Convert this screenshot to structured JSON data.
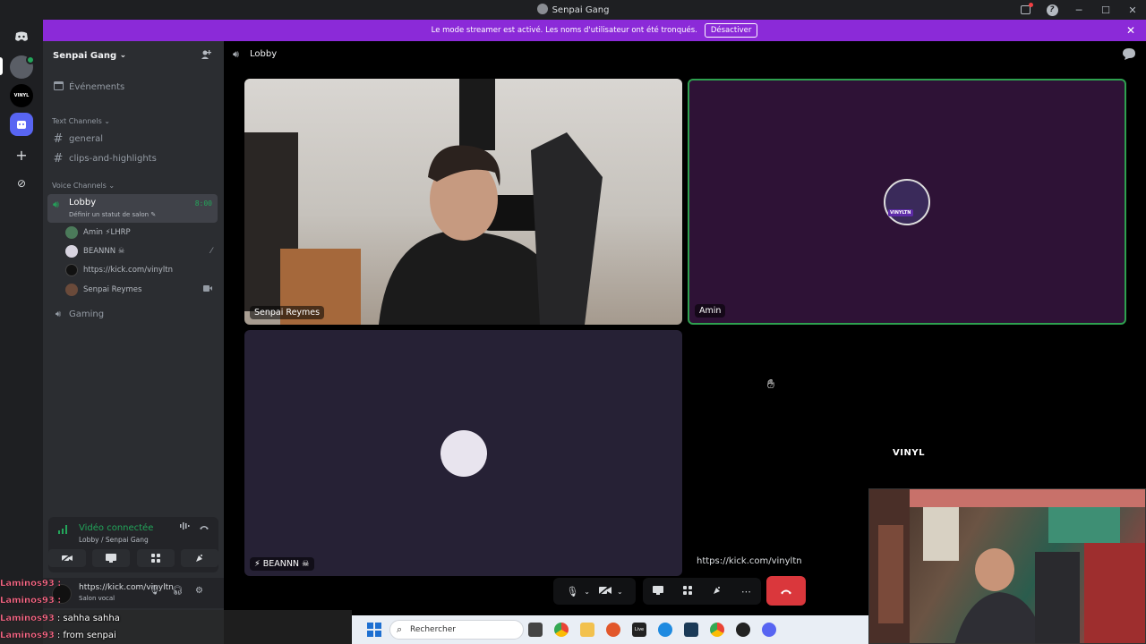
{
  "window": {
    "title": "Senpai Gang",
    "help_glyph": "?",
    "minimize_glyph": "─",
    "maximize_glyph": "☐",
    "close_glyph": "✕"
  },
  "banner": {
    "text": "Le mode streamer est activé. Les noms d'utilisateur ont été tronqués.",
    "button": "Désactiver",
    "close_glyph": "✕",
    "color": "#8b2ad8"
  },
  "rail": {
    "vinyl_label": "VINYL",
    "add_glyph": "+",
    "discover_glyph": "⊘"
  },
  "server": {
    "name": "Senpai Gang",
    "chevron": "⌄",
    "events_label": "Événements",
    "text_category": "Text Channels",
    "voice_category": "Voice Channels",
    "text_channels": [
      "general",
      "clips-and-highlights"
    ],
    "lobby": {
      "name": "Lobby",
      "status": "Définir un statut de salon ✎",
      "timer": "8:00"
    },
    "voice_users": [
      {
        "name": "Amin ⚡LHRP",
        "color": "#4b7a5a"
      },
      {
        "name": "BEANNN ☠",
        "color": "#d8d4e0"
      },
      {
        "name": "https://kick.com/vinyltn",
        "color": "#111111"
      },
      {
        "name": "Senpai Reymes",
        "color": "#6a4a3a"
      }
    ],
    "gaming_channel": "Gaming"
  },
  "voice_panel": {
    "status": "Vidéo connectée",
    "location": "Lobby / Senpai Gang"
  },
  "user_panel": {
    "name": "https://kick.com/vinyltn",
    "status": "Salon vocal"
  },
  "main": {
    "channel": "Lobby",
    "tiles": [
      {
        "label": "Senpai Reymes"
      },
      {
        "label": "Amin"
      },
      {
        "label": "⚡ BEANNN ☠"
      }
    ],
    "link_label": "https://kick.com/vinyltn",
    "vinyl_tag": "VINYL",
    "avatar_badge": "VINYLTN"
  },
  "taskbar": {
    "search_placeholder": "Rechercher",
    "live_label": "Live"
  },
  "chat_overlay": [
    {
      "user": "Laminos93 :",
      "message": ""
    },
    {
      "user": "Laminos93 :",
      "message": ""
    },
    {
      "user": "Laminos93",
      "message": ": sahha sahha"
    },
    {
      "user": "Laminos93",
      "message": ": from senpai"
    }
  ],
  "colors": {
    "accent_green": "#23a55a",
    "hangup_red": "#da373c",
    "sidebar_bg": "#2b2d31"
  }
}
